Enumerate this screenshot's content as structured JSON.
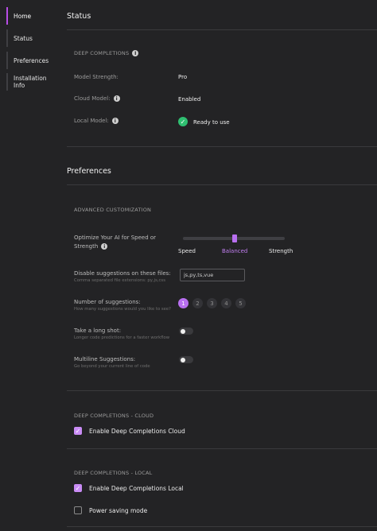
{
  "sidebar": {
    "items": [
      {
        "label": "Home"
      },
      {
        "label": "Status"
      },
      {
        "label": "Preferences"
      },
      {
        "label": "Installation Info"
      }
    ]
  },
  "status": {
    "title": "Status",
    "section_label": "DEEP COMPLETIONS",
    "rows": [
      {
        "label": "Model Strength:",
        "value": "Pro"
      },
      {
        "label": "Cloud Model:",
        "value": "Enabled"
      },
      {
        "label": "Local Model:",
        "value": "Ready to use"
      }
    ]
  },
  "preferences": {
    "title": "Preferences",
    "section_label": "ADVANCED CUSTOMIZATION",
    "optimize": {
      "label_line1": "Optimize Your AI for Speed or",
      "label_line2": "Strength",
      "slider_options": [
        "Speed",
        "Balanced",
        "Strength"
      ],
      "selected": "Balanced"
    },
    "disable": {
      "title": "Disable suggestions on these files:",
      "subtitle": "Comma separated file extensions: py,js,css",
      "value": "js,py,ts,vue"
    },
    "num_suggestions": {
      "title": "Number of suggestions:",
      "subtitle": "How many suggestions would you like to see?",
      "options": [
        "1",
        "2",
        "3",
        "4",
        "5"
      ],
      "selected": "1"
    },
    "long_shot": {
      "title": "Take a long shot:",
      "subtitle": "Longer code predictions for a faster workflow",
      "enabled": false
    },
    "multiline": {
      "title": "Multiline Suggestions:",
      "subtitle": "Go beyond your current line of code",
      "enabled": false
    }
  },
  "cloud": {
    "section_label": "DEEP COMPLETIONS - CLOUD",
    "checkbox_label": "Enable Deep Completions Cloud",
    "checked": true
  },
  "local": {
    "section_label": "DEEP COMPLETIONS - LOCAL",
    "enable_label": "Enable Deep Completions Local",
    "enable_checked": true,
    "power_label": "Power saving mode",
    "power_checked": false
  },
  "icons": {
    "info": "info-icon",
    "ready": "check-circle-icon",
    "checkbox_checked": "checkmark-icon"
  },
  "colors": {
    "accent": "#b86ff0",
    "ready_green": "#2fbf71",
    "background": "#232325"
  }
}
